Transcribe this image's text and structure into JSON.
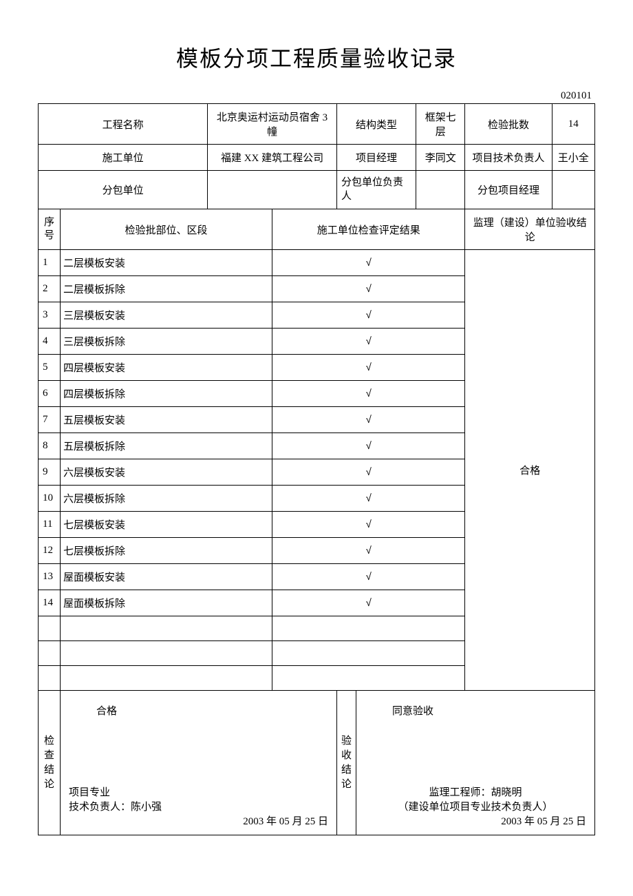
{
  "title": "模板分项工程质量验收记录",
  "doc_number": "020101",
  "header": {
    "project_name_label": "工程名称",
    "project_name": "北京奥运村运动员宿舍 3 幢",
    "structure_type_label": "结构类型",
    "structure_type": "框架七层",
    "batch_count_label": "检验批数",
    "batch_count": "14",
    "construction_unit_label": "施工单位",
    "construction_unit": "福建 XX 建筑工程公司",
    "pm_label": "项目经理",
    "pm": "李同文",
    "tech_lead_label": "项目技术负责人",
    "tech_lead": "王小全",
    "subcontractor_label": "分包单位",
    "subcontractor": "",
    "sub_lead_label": "分包单位负责人",
    "sub_lead": "",
    "sub_pm_label": "分包项目经理",
    "sub_pm": ""
  },
  "columns": {
    "seq": "序号",
    "part": "检验批部位、区段",
    "check_result": "施工单位检查评定结果",
    "supervision": "监理（建设）单位验收结论"
  },
  "rows": [
    {
      "seq": "1",
      "part": "二层模板安装",
      "check": "√"
    },
    {
      "seq": "2",
      "part": "二层模板拆除",
      "check": "√"
    },
    {
      "seq": "3",
      "part": "三层模板安装",
      "check": "√"
    },
    {
      "seq": "4",
      "part": "三层模板拆除",
      "check": "√"
    },
    {
      "seq": "5",
      "part": "四层模板安装",
      "check": "√"
    },
    {
      "seq": "6",
      "part": "四层模板拆除",
      "check": "√"
    },
    {
      "seq": "7",
      "part": "五层模板安装",
      "check": "√"
    },
    {
      "seq": "8",
      "part": "五层模板拆除",
      "check": "√"
    },
    {
      "seq": "9",
      "part": "六层模板安装",
      "check": "√"
    },
    {
      "seq": "10",
      "part": "六层模板拆除",
      "check": "√"
    },
    {
      "seq": "11",
      "part": "七层模板安装",
      "check": "√"
    },
    {
      "seq": "12",
      "part": "七层模板拆除",
      "check": "√"
    },
    {
      "seq": "13",
      "part": "屋面模板安装",
      "check": "√"
    },
    {
      "seq": "14",
      "part": "屋面模板拆除",
      "check": "√"
    }
  ],
  "supervision_result": "合格",
  "footer": {
    "left_label": "检查结论",
    "left_result": "合格",
    "left_sign_label1": "项目专业",
    "left_sign_label2": "技术负责人：陈小强",
    "left_date": "2003 年 05 月 25 日",
    "right_label": "验收结论",
    "right_result": "同意验收",
    "right_sign1": "监理工程师：胡晓明",
    "right_sign2": "（建设单位项目专业技术负责人）",
    "right_date": "2003 年 05 月 25 日"
  }
}
